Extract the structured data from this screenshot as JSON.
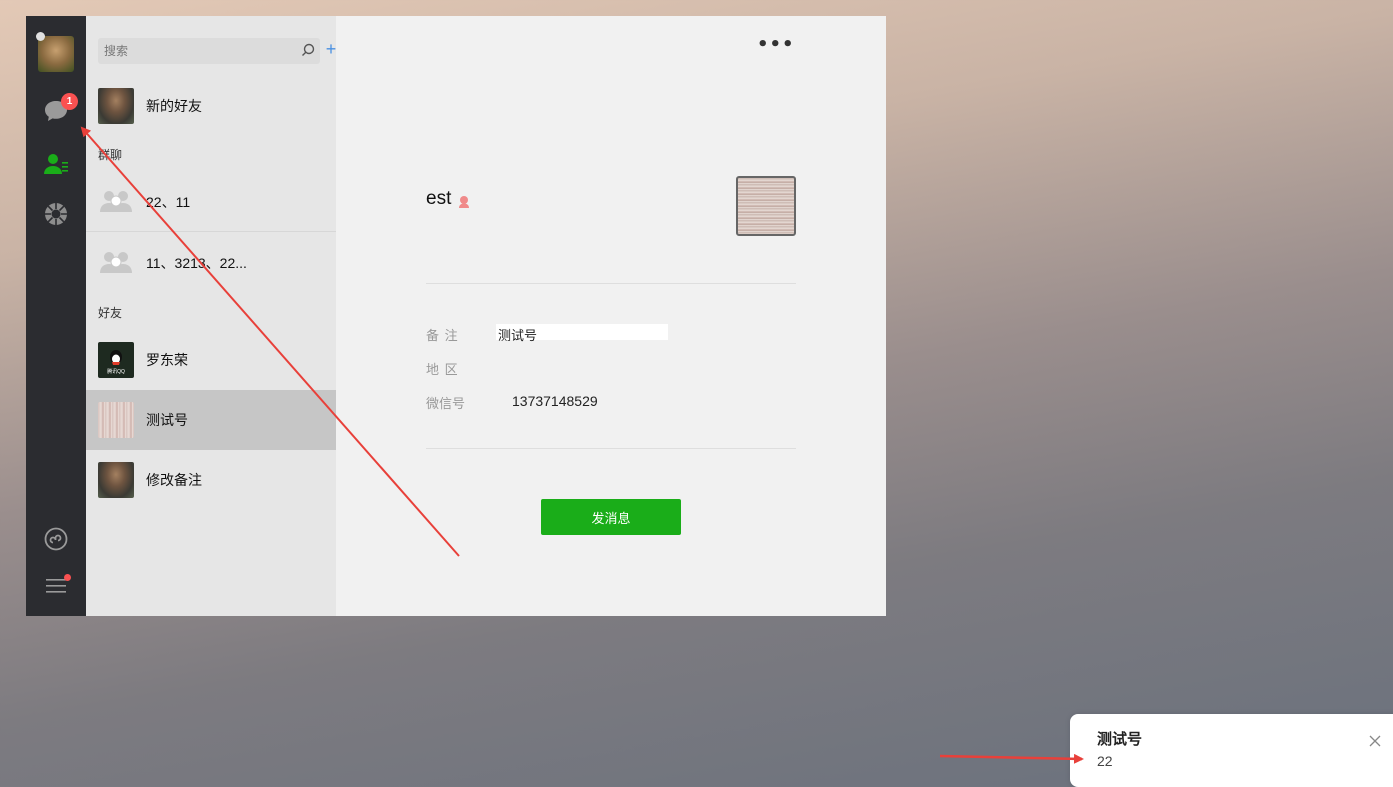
{
  "search": {
    "placeholder": "搜索"
  },
  "nav": {
    "chat_badge": "1"
  },
  "list": {
    "new_friends": "新的好友",
    "group_section": "群聊",
    "groups": [
      "22、11",
      "11、3213、22..."
    ],
    "friend_section": "好友",
    "friends": [
      "罗东荣",
      "测试号",
      "修改备注"
    ]
  },
  "contact": {
    "name": "est",
    "remark_label": "备 注",
    "remark_value": "测试号",
    "region_label": "地 区",
    "wechat_label": "微信号",
    "wechat_value": "13737148529",
    "send_button": "发消息"
  },
  "toast": {
    "title": "测试号",
    "body": "22"
  },
  "colors": {
    "accent_green": "#1aad19",
    "badge_red": "#fa5151",
    "arrow_red": "#e8403a"
  }
}
